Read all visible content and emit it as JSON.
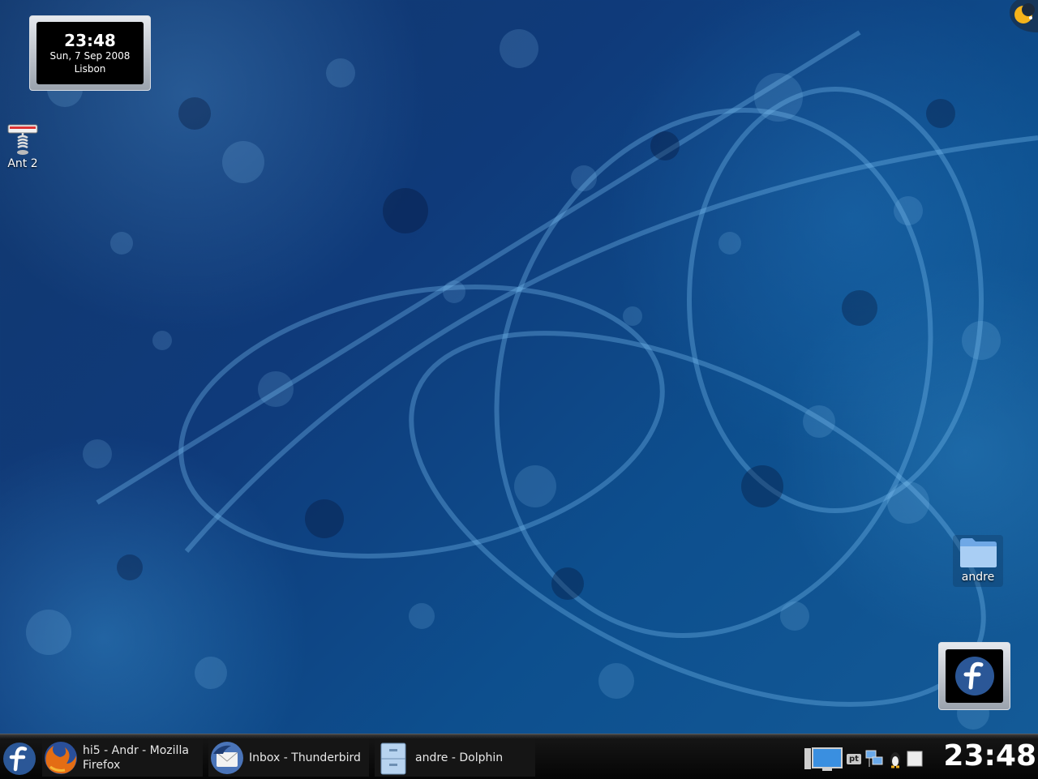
{
  "clock_widget": {
    "time": "23:48",
    "date": "Sun, 7 Sep 2008",
    "city": "Lisbon"
  },
  "desktop_icons": [
    {
      "label": "Ant 2",
      "icon": "ant-build-icon"
    },
    {
      "label": "andre",
      "icon": "folder-icon"
    }
  ],
  "taskbar": {
    "tasks": [
      {
        "title": "hi5 - Andr - Mozilla Firefox",
        "icon": "firefox-icon"
      },
      {
        "title": "Inbox - Thunderbird",
        "icon": "thunderbird-icon"
      },
      {
        "title": "andre - Dolphin",
        "icon": "file-cabinet-icon"
      }
    ],
    "tray": {
      "keyboard_layout": "pt"
    },
    "clock": "23:48"
  },
  "colors": {
    "desktop_blue": "#0f3a7a",
    "fedora_blue": "#2b5797",
    "panel_black": "#050505"
  }
}
